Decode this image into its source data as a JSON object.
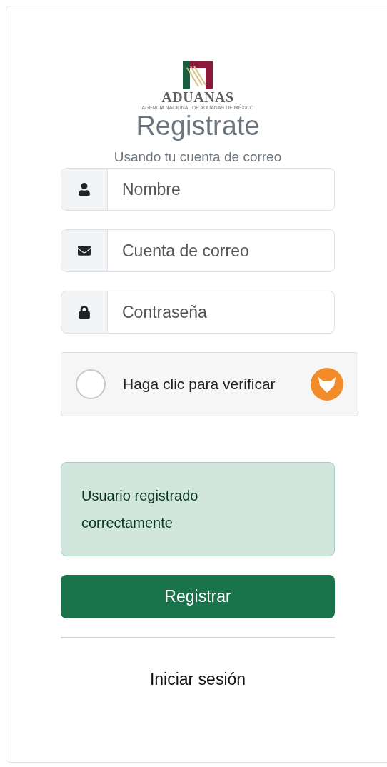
{
  "logo": {
    "name": "ADUANAS",
    "subtitle": "AGENCIA NACIONAL DE ADUANAS DE MÉXICO"
  },
  "title": "Registrate",
  "subtitle": "Usando tu cuenta de correo",
  "fields": [
    {
      "kind": "user",
      "placeholder": "Nombre"
    },
    {
      "kind": "email",
      "placeholder": "Cuenta de correo"
    },
    {
      "kind": "password",
      "placeholder": "Contraseña"
    }
  ],
  "captcha": {
    "label": "Haga clic para verificar",
    "checked": false
  },
  "alert": {
    "text": "Usuario registrado correctamente"
  },
  "submit": "Registrar",
  "login_link": "Iniciar sesión"
}
